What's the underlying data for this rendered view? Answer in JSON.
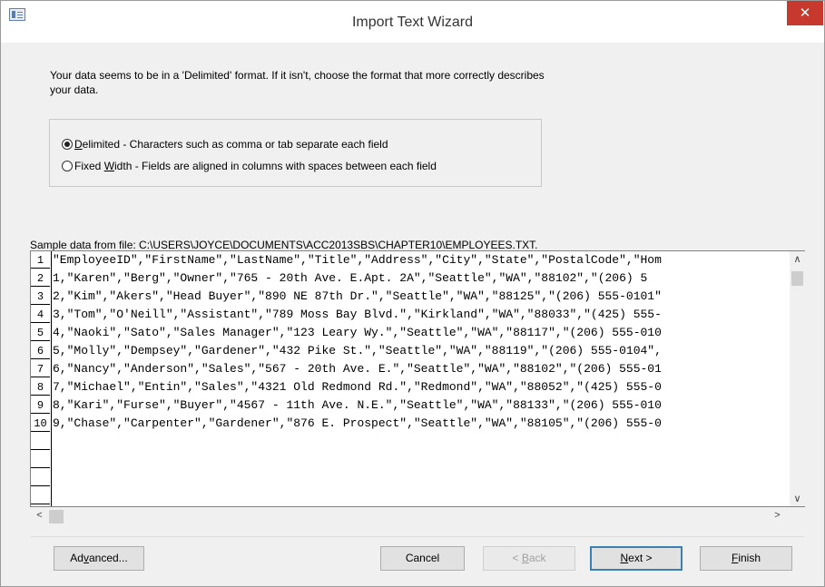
{
  "window": {
    "title": "Import Text Wizard",
    "close_glyph": "✕"
  },
  "description": "Your data seems to be in a 'Delimited' format. If it isn't, choose the format that more correctly describes your data.",
  "format_options": [
    {
      "accel": "D",
      "rest": "elimited - Characters such as comma or tab separate each field",
      "selected": true
    },
    {
      "lead": "Fixed ",
      "accel": "W",
      "rest": "idth - Fields are aligned in columns with spaces between each field",
      "selected": false
    }
  ],
  "sample": {
    "label": "Sample data from file: C:\\USERS\\JOYCE\\DOCUMENTS\\ACC2013SBS\\CHAPTER10\\EMPLOYEES.TXT.",
    "row_numbers": [
      "1",
      "2",
      "3",
      "4",
      "5",
      "6",
      "7",
      "8",
      "9",
      "10",
      "",
      "",
      "",
      ""
    ],
    "rows": [
      "\"EmployeeID\",\"FirstName\",\"LastName\",\"Title\",\"Address\",\"City\",\"State\",\"PostalCode\",\"Hom",
      "1,\"Karen\",\"Berg\",\"Owner\",\"765 - 20th Ave. E.Apt. 2A\",\"Seattle\",\"WA\",\"88102\",\"(206) 5",
      "2,\"Kim\",\"Akers\",\"Head Buyer\",\"890 NE 87th Dr.\",\"Seattle\",\"WA\",\"88125\",\"(206) 555-0101\"",
      "3,\"Tom\",\"O'Neill\",\"Assistant\",\"789 Moss Bay Blvd.\",\"Kirkland\",\"WA\",\"88033\",\"(425) 555-",
      "4,\"Naoki\",\"Sato\",\"Sales Manager\",\"123 Leary Wy.\",\"Seattle\",\"WA\",\"88117\",\"(206) 555-010",
      "5,\"Molly\",\"Dempsey\",\"Gardener\",\"432 Pike St.\",\"Seattle\",\"WA\",\"88119\",\"(206) 555-0104\",",
      "6,\"Nancy\",\"Anderson\",\"Sales\",\"567 - 20th Ave. E.\",\"Seattle\",\"WA\",\"88102\",\"(206) 555-01",
      "7,\"Michael\",\"Entin\",\"Sales\",\"4321 Old Redmond Rd.\",\"Redmond\",\"WA\",\"88052\",\"(425) 555-0",
      "8,\"Kari\",\"Furse\",\"Buyer\",\"4567 - 11th Ave. N.E.\",\"Seattle\",\"WA\",\"88133\",\"(206) 555-010",
      "9,\"Chase\",\"Carpenter\",\"Gardener\",\"876 E. Prospect\",\"Seattle\",\"WA\",\"88105\",\"(206) 555-0"
    ]
  },
  "scroll_glyphs": {
    "up": "∧",
    "down": "∨",
    "left": "<",
    "right": ">"
  },
  "buttons": {
    "advanced": {
      "pre": "Ad",
      "accel": "v",
      "post": "anced..."
    },
    "cancel": {
      "label": "Cancel"
    },
    "back": {
      "pre": "< ",
      "accel": "B",
      "post": "ack"
    },
    "next": {
      "pre": "",
      "accel": "N",
      "post": "ext >"
    },
    "finish": {
      "pre": "",
      "accel": "F",
      "post": "inish"
    }
  }
}
